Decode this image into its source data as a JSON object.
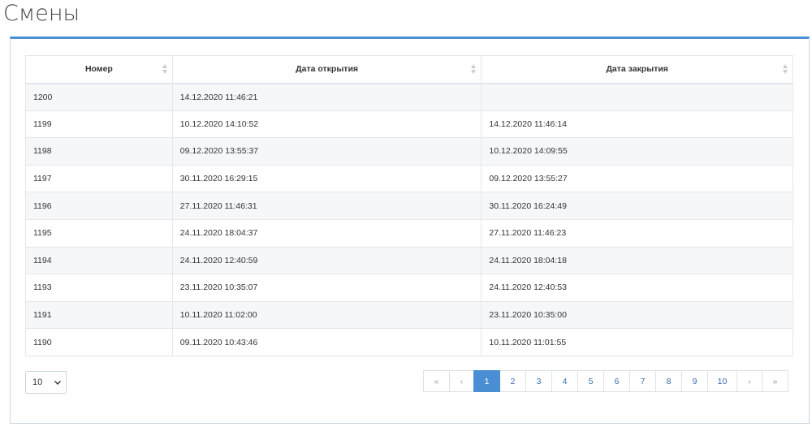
{
  "page": {
    "title": "Смены"
  },
  "table": {
    "columns": [
      "Номер",
      "Дата открытия",
      "Дата закрытия"
    ],
    "rows": [
      [
        "1200",
        "14.12.2020 11:46:21",
        ""
      ],
      [
        "1199",
        "10.12.2020 14:10:52",
        "14.12.2020 11:46:14"
      ],
      [
        "1198",
        "09.12.2020 13:55:37",
        "10.12.2020 14:09:55"
      ],
      [
        "1197",
        "30.11.2020 16:29:15",
        "09.12.2020 13:55:27"
      ],
      [
        "1196",
        "27.11.2020 11:46:31",
        "30.11.2020 16:24:49"
      ],
      [
        "1195",
        "24.11.2020 18:04:37",
        "27.11.2020 11:46:23"
      ],
      [
        "1194",
        "24.11.2020 12:40:59",
        "24.11.2020 18:04:18"
      ],
      [
        "1193",
        "23.11.2020 10:35:07",
        "24.11.2020 12:40:53"
      ],
      [
        "1191",
        "10.11.2020 11:02:00",
        "23.11.2020 10:35:00"
      ],
      [
        "1190",
        "09.11.2020 10:43:46",
        "10.11.2020 11:01:55"
      ]
    ]
  },
  "page_size": {
    "value": "10"
  },
  "pagination": {
    "first": "«",
    "prev": "‹",
    "pages": [
      "1",
      "2",
      "3",
      "4",
      "5",
      "6",
      "7",
      "8",
      "9",
      "10"
    ],
    "active": "1",
    "next": "›",
    "last": "»"
  },
  "colors": {
    "accent": "#4a8fd4",
    "link": "#3a6eb5",
    "stripe": "#f6f7f8",
    "border": "#e3e6ea"
  },
  "icons": {
    "sort": "sort-both-icon",
    "select": "chevron-down-icon"
  }
}
